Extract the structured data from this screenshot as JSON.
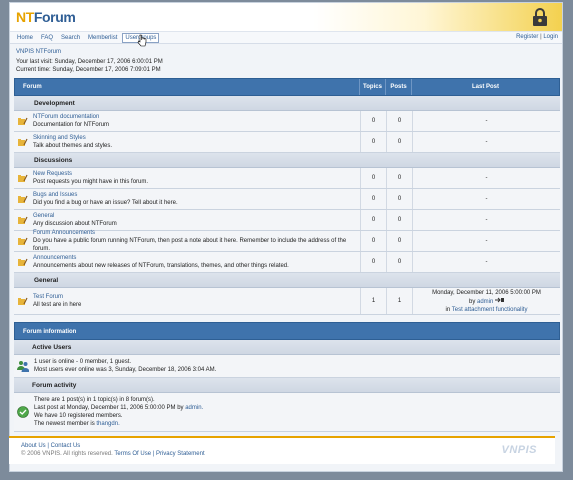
{
  "header": {
    "logo_nt": "NT",
    "logo_forum": "Forum"
  },
  "nav": {
    "items": [
      {
        "label": "Home"
      },
      {
        "label": "FAQ"
      },
      {
        "label": "Search"
      },
      {
        "label": "Memberlist"
      },
      {
        "label": "Usergroups"
      }
    ],
    "register": "Register",
    "separator": "|",
    "login": "Login"
  },
  "welcome": {
    "breadcrumb": "VNPIS NTForum",
    "last_visit": "Your last visit: Sunday, December 17, 2006 6:00:01 PM",
    "current_time": "Current time: Sunday, December 17, 2006 7:09:01 PM"
  },
  "table": {
    "headers": {
      "forum": "Forum",
      "topics": "Topics",
      "posts": "Posts",
      "last_post": "Last Post"
    },
    "categories": [
      {
        "name": "Development",
        "forums": [
          {
            "name": "NTForum documentation",
            "desc": "Documentation for NTForum",
            "topics": "0",
            "posts": "0",
            "last": "-"
          },
          {
            "name": "Skinning and Styles",
            "desc": "Talk about themes and styles.",
            "topics": "0",
            "posts": "0",
            "last": "-"
          }
        ]
      },
      {
        "name": "Discussions",
        "forums": [
          {
            "name": "New Requests",
            "desc": "Post requests you might have in this forum.",
            "topics": "0",
            "posts": "0",
            "last": "-"
          },
          {
            "name": "Bugs and Issues",
            "desc": "Did you find a bug or have an issue? Tell about it here.",
            "topics": "0",
            "posts": "0",
            "last": "-"
          },
          {
            "name": "General",
            "desc": "Any discussion about NTForum",
            "topics": "0",
            "posts": "0",
            "last": "-"
          },
          {
            "name": "Forum Announcements",
            "desc": "Do you have a public forum running NTForum, then post a note about it here. Remember to include the address of the forum.",
            "topics": "0",
            "posts": "0",
            "last": "-"
          },
          {
            "name": "Announcements",
            "desc": "Announcements about new releases of NTForum, translations, themes, and other things related.",
            "topics": "0",
            "posts": "0",
            "last": "-"
          }
        ]
      },
      {
        "name": "General",
        "forums": [
          {
            "name": "Test Forum",
            "desc": "All test are in here",
            "topics": "1",
            "posts": "1",
            "last": "Monday, December 11, 2006 5:00:00 PM",
            "last_by": "by",
            "last_user": "admin",
            "last_in": "in",
            "last_topic": "Test attachment functionality"
          }
        ]
      }
    ]
  },
  "forum_info": {
    "title": "Forum information",
    "active_users": {
      "label": "Active Users",
      "line1": "1 user is online - 0 member, 1 guest.",
      "line2": "Most users ever online was 3, Sunday, December 18, 2006 3:04 AM."
    },
    "activity": {
      "label": "Forum activity",
      "line1": "There are 1 post(s) in 1 topic(s) in 8 forum(s).",
      "line2": "Last post at Monday, December 11, 2006 5:00:00 PM by",
      "line2_user": "admin.",
      "line3": "We have 10 registered members.",
      "line4": "The newest member is",
      "line4_user": "thangdn."
    }
  },
  "footer": {
    "about": "About Us",
    "separator": "|",
    "contact": "Contact Us",
    "copyright": "© 2006 VNPIS. All rights reserved.",
    "terms": "Terms Of Use",
    "privacy": "Privacy Statement",
    "brand": "VNPIS"
  },
  "colors": {
    "accent": "#3f73ac",
    "logo_orange": "#e7a300",
    "link": "#2f5e95"
  }
}
